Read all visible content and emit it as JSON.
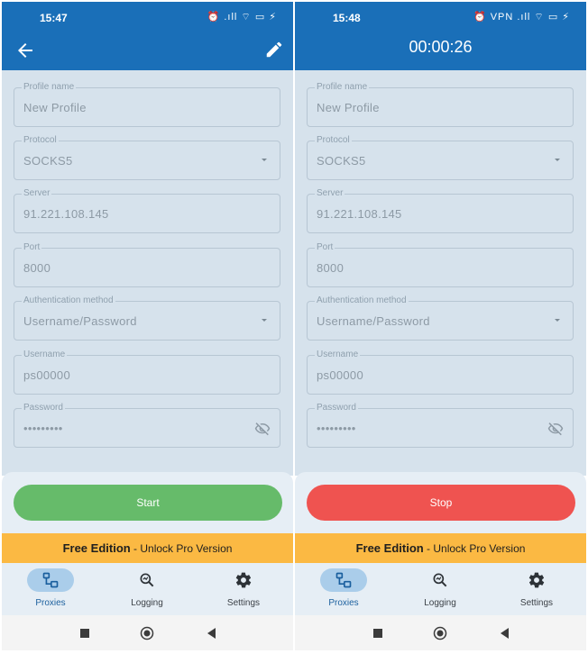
{
  "screens": [
    {
      "status_time": "15:47",
      "status_icons": "⏰ .ıll ⌔ ▭ ⚡",
      "appbar": {
        "title": "",
        "back_icon": "arrow-left-icon",
        "edit_icon": "pencil-icon"
      },
      "fields": [
        {
          "label": "Profile name",
          "value": "New Profile",
          "kind": "text"
        },
        {
          "label": "Protocol",
          "value": "SOCKS5",
          "kind": "dropdown"
        },
        {
          "label": "Server",
          "value": "91.221.108.145",
          "kind": "text"
        },
        {
          "label": "Port",
          "value": "8000",
          "kind": "text"
        },
        {
          "label": "Authentication method",
          "value": "Username/Password",
          "kind": "dropdown"
        },
        {
          "label": "Username",
          "value": "ps00000",
          "kind": "text"
        },
        {
          "label": "Password",
          "value": "•••••••••",
          "kind": "password"
        }
      ],
      "action_button": {
        "label": "Start",
        "color": "#66bb6a"
      },
      "promo": {
        "strong": "Free Edition",
        "rest": " - Unlock Pro Version"
      },
      "nav": [
        {
          "label": "Proxies",
          "icon": "proxies-icon",
          "active": true
        },
        {
          "label": "Logging",
          "icon": "logging-icon",
          "active": false
        },
        {
          "label": "Settings",
          "icon": "gear-icon",
          "active": false
        }
      ]
    },
    {
      "status_time": "15:48",
      "status_icons": "⏰ VPN .ıll ⌔ ▭ ⚡",
      "appbar": {
        "title": "00:00:26"
      },
      "fields": [
        {
          "label": "Profile name",
          "value": "New Profile",
          "kind": "text"
        },
        {
          "label": "Protocol",
          "value": "SOCKS5",
          "kind": "dropdown"
        },
        {
          "label": "Server",
          "value": "91.221.108.145",
          "kind": "text"
        },
        {
          "label": "Port",
          "value": "8000",
          "kind": "text"
        },
        {
          "label": "Authentication method",
          "value": "Username/Password",
          "kind": "dropdown"
        },
        {
          "label": "Username",
          "value": "ps00000",
          "kind": "text"
        },
        {
          "label": "Password",
          "value": "•••••••••",
          "kind": "password"
        }
      ],
      "action_button": {
        "label": "Stop",
        "color": "#ef5350"
      },
      "promo": {
        "strong": "Free Edition",
        "rest": " - Unlock Pro Version"
      },
      "nav": [
        {
          "label": "Proxies",
          "icon": "proxies-icon",
          "active": true
        },
        {
          "label": "Logging",
          "icon": "logging-icon",
          "active": false
        },
        {
          "label": "Settings",
          "icon": "gear-icon",
          "active": false
        }
      ]
    }
  ],
  "colors": {
    "primary": "#1a6fb8",
    "form_background": "#d6e2ec",
    "promo_background": "#fbb943",
    "nav_active_pill": "#aacdea"
  }
}
